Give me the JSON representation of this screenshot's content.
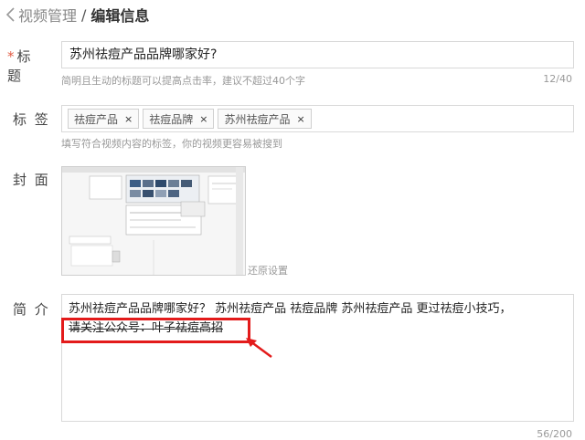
{
  "breadcrumb": {
    "parent": "视频管理",
    "separator": "/",
    "current": "编辑信息"
  },
  "title_field": {
    "label": "标 题",
    "required_mark": "*",
    "value": "苏州祛痘产品品牌哪家好?",
    "hint": "简明且生动的标题可以提高点击率，建议不超过40个字",
    "counter": "12/40"
  },
  "tags_field": {
    "label": "标 签",
    "tags": [
      {
        "label": "祛痘产品",
        "remove": "×"
      },
      {
        "label": "祛痘品牌",
        "remove": "×"
      },
      {
        "label": "苏州祛痘产品",
        "remove": "×"
      }
    ],
    "hint": "填写符合视频内容的标签，你的视频更容易被搜到"
  },
  "cover_field": {
    "label": "封 面",
    "reset_label": "还原设置"
  },
  "desc_field": {
    "label": "简 介",
    "line1": "苏州祛痘产品品牌哪家好？ 苏州祛痘产品 祛痘品牌 苏州祛痘产品   更过祛痘小技巧，",
    "line2": "请关注公众号：叶子祛痘高招",
    "counter": "56/200"
  },
  "annotation": {
    "color": "#e31b1b"
  },
  "icons": {
    "back": "chevron-left-icon",
    "tag_remove": "close-icon"
  }
}
